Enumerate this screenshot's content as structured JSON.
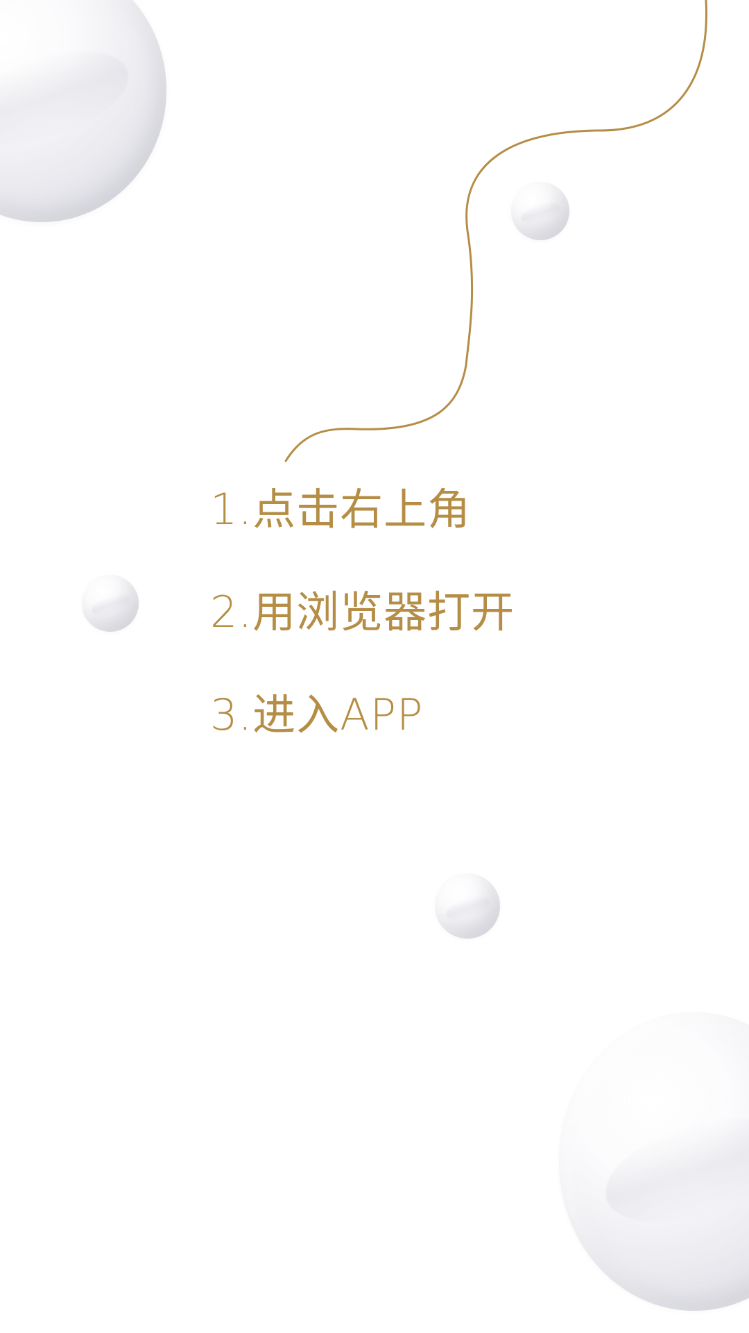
{
  "colors": {
    "accent": "#B58D45",
    "background": "#FFFFFF"
  },
  "decorations": {
    "wave_icon": "wavy-line-icon",
    "pearl_icon": "pearl-icon"
  },
  "instructions": {
    "steps": [
      "1.点击右上角",
      "2.用浏览器打开",
      "3.进入APP"
    ]
  }
}
